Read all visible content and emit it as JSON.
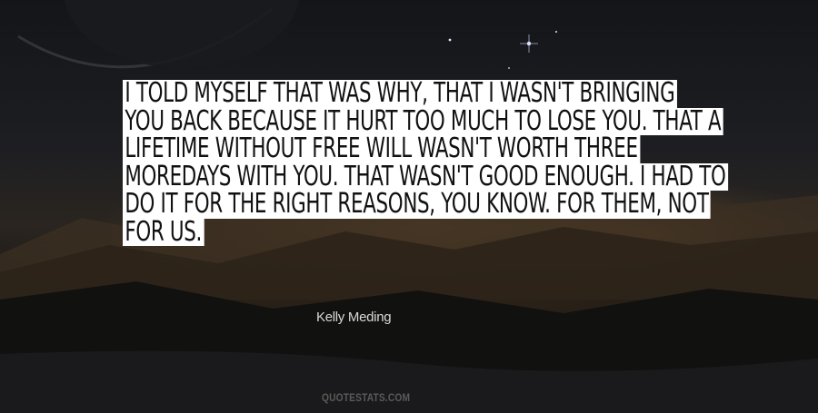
{
  "quote": {
    "lines": [
      "I TOLD MYSELF THAT WAS WHY, THAT I WASN'T BRINGING",
      "YOU BACK BECAUSE IT HURT TOO MUCH TO LOSE YOU. THAT A",
      "LIFETIME WITHOUT FREE WILL WASN'T WORTH THREE",
      "MOREDAYS WITH YOU. THAT WASN'T GOOD ENOUGH. I HAD TO",
      "DO IT FOR THE RIGHT REASONS, YOU KNOW. FOR THEM, NOT",
      "FOR US."
    ]
  },
  "author": "Kelly Meding",
  "watermark": "QUOTESTATS.COM",
  "colors": {
    "highlight": "#ffffff",
    "quote_text": "#111111",
    "author_text": "#d8d8d8"
  }
}
